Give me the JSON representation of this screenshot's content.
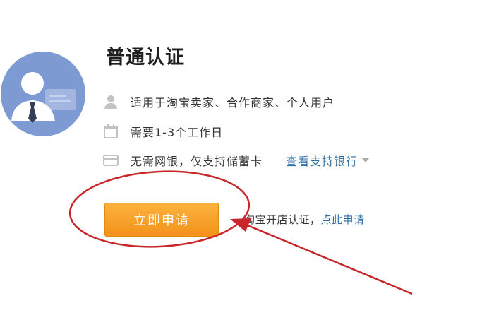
{
  "card": {
    "title": "普通认证",
    "items": [
      {
        "icon": "person-icon",
        "text": "适用于淘宝卖家、合作商家、个人用户"
      },
      {
        "icon": "calendar-icon",
        "text": "需要1-3个工作日"
      },
      {
        "icon": "bank-card-icon",
        "text": "无需网银，仅支持储蓄卡"
      }
    ],
    "bank_link": "查看支持银行",
    "apply_button": "立即申请",
    "shop_prefix": "淘宝开店认证，",
    "shop_link": "点此申请"
  },
  "colors": {
    "accent_orange": "#f5a02a",
    "link_blue": "#2f6fa8",
    "avatar_blue": "#7e9ad2",
    "annotation_red": "#c9262b"
  }
}
